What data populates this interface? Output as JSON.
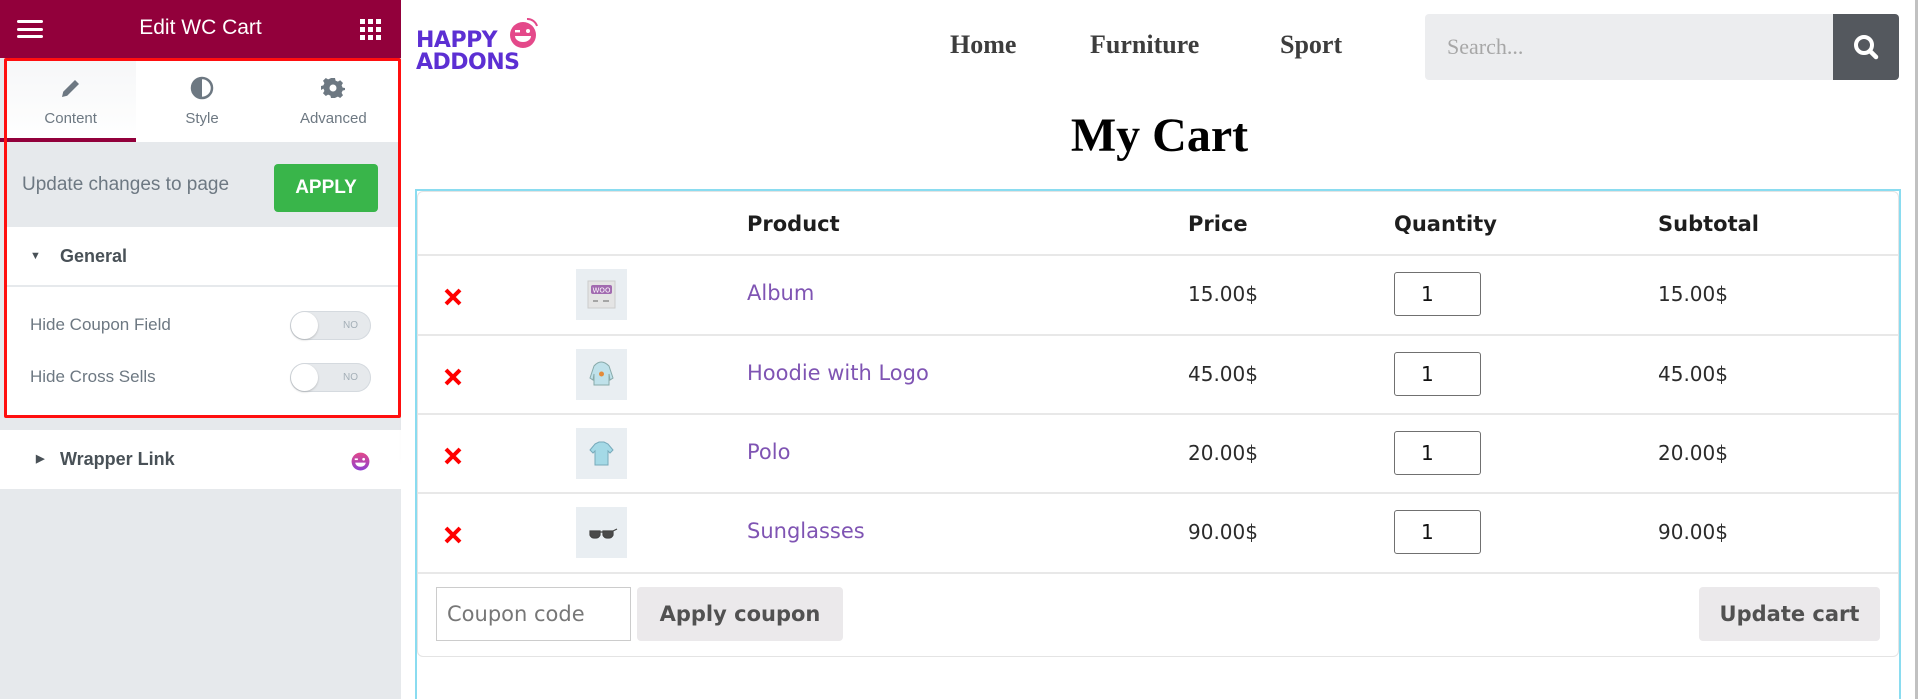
{
  "editor": {
    "title": "Edit WC Cart",
    "menu_icon": "hamburger-icon",
    "apps_icon": "grid-icon",
    "brand_color": "#92003B",
    "tabs": [
      {
        "label": "Content",
        "icon": "pencil-icon",
        "active": true
      },
      {
        "label": "Style",
        "icon": "half-circle-icon",
        "active": false
      },
      {
        "label": "Advanced",
        "icon": "gear-icon",
        "active": false
      }
    ],
    "update_text": "Update changes to page",
    "apply_label": "APPLY",
    "apply_color": "#39B54A",
    "sections": {
      "general": {
        "label": "General",
        "expanded": true,
        "controls": [
          {
            "label": "Hide Coupon Field",
            "state": "NO",
            "on": false
          },
          {
            "label": "Hide Cross Sells",
            "state": "NO",
            "on": false
          }
        ]
      },
      "wrapper_link": {
        "label": "Wrapper Link",
        "expanded": false,
        "badge_icon": "happy-addons-icon"
      }
    },
    "collapse_icon": "chevron-left-icon"
  },
  "site": {
    "logo": {
      "line1": "HAPPY",
      "line2": "ADDONS"
    },
    "nav": [
      "Home",
      "Furniture",
      "Sport"
    ],
    "search": {
      "placeholder": "Search...",
      "value": "",
      "icon": "search-icon"
    }
  },
  "cart": {
    "title": "My Cart",
    "headers": {
      "remove": "",
      "thumbnail": "",
      "product": "Product",
      "price": "Price",
      "quantity": "Quantity",
      "subtotal": "Subtotal"
    },
    "items": [
      {
        "name": "Album",
        "price": "15.00$",
        "quantity": "1",
        "subtotal": "15.00$",
        "thumb": "album-thumbnail"
      },
      {
        "name": "Hoodie with Logo",
        "price": "45.00$",
        "quantity": "1",
        "subtotal": "45.00$",
        "thumb": "hoodie-thumbnail"
      },
      {
        "name": "Polo",
        "price": "20.00$",
        "quantity": "1",
        "subtotal": "20.00$",
        "thumb": "polo-thumbnail"
      },
      {
        "name": "Sunglasses",
        "price": "90.00$",
        "quantity": "1",
        "subtotal": "90.00$",
        "thumb": "sunglasses-thumbnail"
      }
    ],
    "coupon_placeholder": "Coupon code",
    "apply_coupon_label": "Apply coupon",
    "update_cart_label": "Update cart",
    "link_color": "#7F54B3",
    "remove_color": "#FF0000"
  }
}
